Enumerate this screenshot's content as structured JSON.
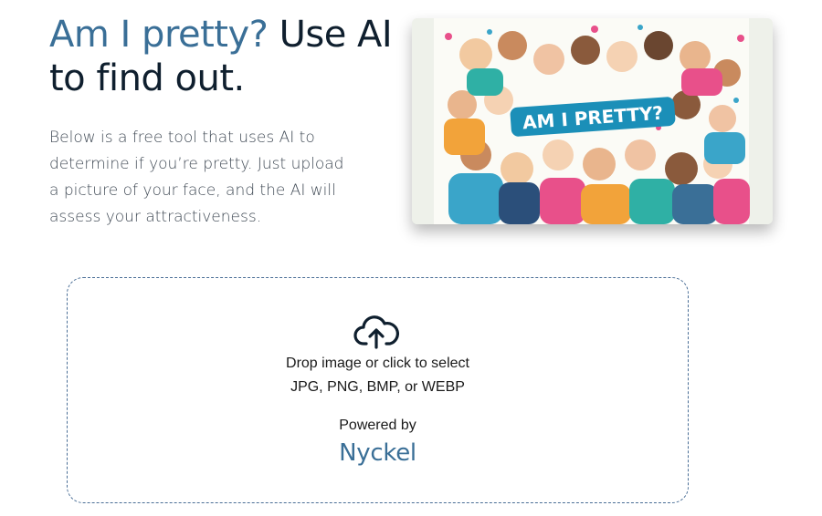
{
  "hero": {
    "title_accent": "Am I pretty?",
    "title_rest": " Use AI to find out.",
    "description": "Below is a free tool that uses AI to determine if you’re pretty. Just upload a picture of your face, and the AI will assess your attractiveness.",
    "image_banner_text": "AM I PRETTY?"
  },
  "upload": {
    "icon": "cloud-upload-icon",
    "line1": "Drop image or click to select",
    "line2": "JPG, PNG, BMP, or WEBP",
    "powered_by_label": "Powered by",
    "brand_name": "Nyckel"
  },
  "colors": {
    "accent": "#3a6f97",
    "text_dark": "#0f1f2e",
    "dropzone_border": "#4a6e96"
  }
}
